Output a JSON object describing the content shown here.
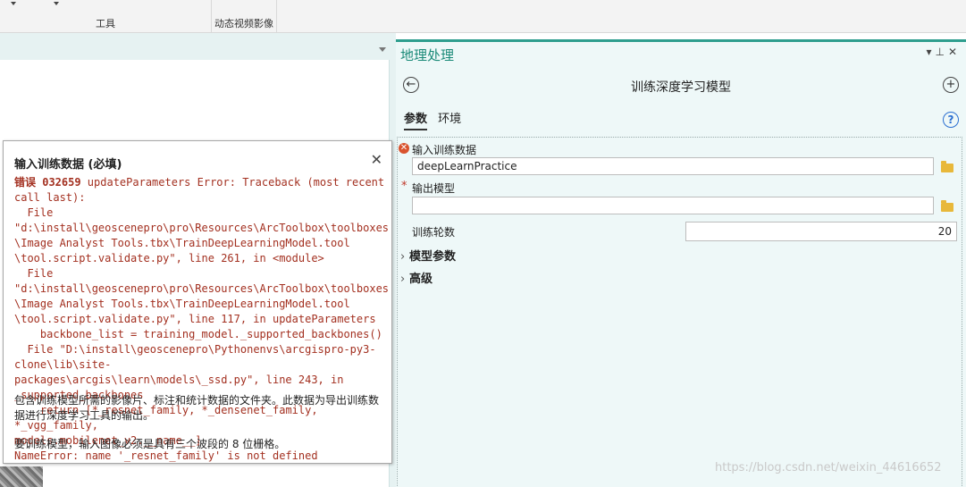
{
  "ribbon": {
    "group_tools": "工具",
    "group_dynamic": "动态视频影像"
  },
  "tooltip": {
    "title": "输入训练数据 (必填)",
    "error_code": "错误 032659",
    "error_text": " updateParameters Error: Traceback (most recent call last):\n  File \"d:\\install\\geoscenepro\\pro\\Resources\\ArcToolbox\\toolboxes\n\\Image Analyst Tools.tbx\\TrainDeepLearningModel.tool\n\\tool.script.validate.py\", line 261, in <module>\n  File \"d:\\install\\geoscenepro\\pro\\Resources\\ArcToolbox\\toolboxes\n\\Image Analyst Tools.tbx\\TrainDeepLearningModel.tool\n\\tool.script.validate.py\", line 117, in updateParameters\n    backbone_list = training_model._supported_backbones()\n  File \"D:\\install\\geoscenepro\\Pythonenvs\\arcgispro-py3-clone\\lib\\site-\npackages\\arcgis\\learn\\models\\_ssd.py\", line 243, in\n_supported_backbones\n    return [*_resnet_family, *_densenet_family, *_vgg_family,\nmodels.mobilenet_v2.__name__]\nNameError: name '_resnet_family' is not defined",
    "desc1": "包含训练模型所需的影像片、标注和统计数据的文件夹。此数据为导出训练数据进行深度学习工具的输出。",
    "desc2": "要训练模型，输入图像必须是具有三个波段的 8 位栅格。"
  },
  "gp": {
    "title": "地理处理",
    "tool_name": "训练深度学习模型",
    "tabs": [
      "参数",
      "环境"
    ],
    "params": {
      "input_label": "输入训练数据",
      "input_value": "deepLearnPractice",
      "output_label": "输出模型",
      "output_value": "",
      "epochs_label": "训练轮数",
      "epochs_value": "20"
    },
    "sections": [
      "模型参数",
      "高级"
    ]
  },
  "watermark": "https://blog.csdn.net/weixin_44616652"
}
